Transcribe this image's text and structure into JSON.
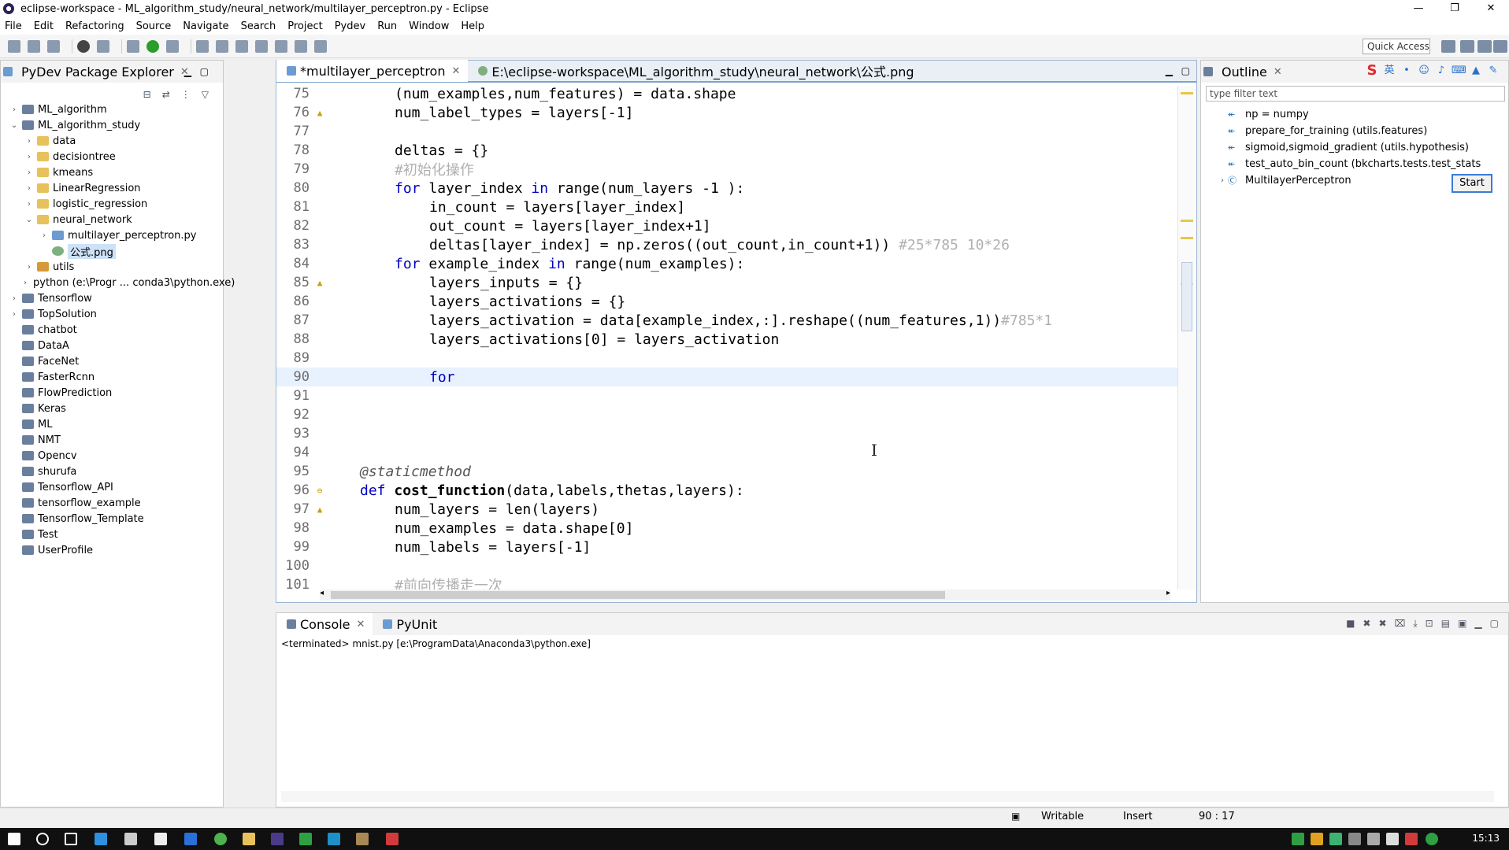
{
  "window": {
    "title": "eclipse-workspace - ML_algorithm_study/neural_network/multilayer_perceptron.py - Eclipse",
    "controls": [
      "—",
      "❐",
      "✕"
    ]
  },
  "menu": [
    "File",
    "Edit",
    "Refactoring",
    "Source",
    "Navigate",
    "Search",
    "Project",
    "Pydev",
    "Run",
    "Window",
    "Help"
  ],
  "toolbar": {
    "quick_access": "Quick Access"
  },
  "explorer": {
    "title": "PyDev Package Explorer",
    "tree": [
      {
        "indent": 0,
        "twisty": "›",
        "icon": "proj",
        "label": "ML_algorithm"
      },
      {
        "indent": 0,
        "twisty": "⌄",
        "icon": "proj",
        "label": "ML_algorithm_study"
      },
      {
        "indent": 1,
        "twisty": "›",
        "icon": "folder",
        "label": "data"
      },
      {
        "indent": 1,
        "twisty": "›",
        "icon": "folder",
        "label": "decisiontree"
      },
      {
        "indent": 1,
        "twisty": "›",
        "icon": "folder",
        "label": "kmeans"
      },
      {
        "indent": 1,
        "twisty": "›",
        "icon": "folder",
        "label": "LinearRegression"
      },
      {
        "indent": 1,
        "twisty": "›",
        "icon": "folder",
        "label": "logistic_regression"
      },
      {
        "indent": 1,
        "twisty": "⌄",
        "icon": "folder",
        "label": "neural_network"
      },
      {
        "indent": 2,
        "twisty": "›",
        "icon": "py",
        "label": "multilayer_perceptron.py"
      },
      {
        "indent": 2,
        "twisty": "",
        "icon": "png",
        "label": "公式.png",
        "selected": true
      },
      {
        "indent": 1,
        "twisty": "›",
        "icon": "pkg",
        "label": "utils"
      },
      {
        "indent": 1,
        "twisty": "›",
        "icon": "py",
        "label": "python   (e:\\Progr ... conda3\\python.exe)"
      },
      {
        "indent": 0,
        "twisty": "›",
        "icon": "proj",
        "label": "Tensorflow"
      },
      {
        "indent": 0,
        "twisty": "›",
        "icon": "proj",
        "label": "TopSolution"
      },
      {
        "indent": 0,
        "twisty": "",
        "icon": "proj",
        "label": "chatbot"
      },
      {
        "indent": 0,
        "twisty": "",
        "icon": "proj",
        "label": "DataA"
      },
      {
        "indent": 0,
        "twisty": "",
        "icon": "proj",
        "label": "FaceNet"
      },
      {
        "indent": 0,
        "twisty": "",
        "icon": "proj",
        "label": "FasterRcnn"
      },
      {
        "indent": 0,
        "twisty": "",
        "icon": "proj",
        "label": "FlowPrediction"
      },
      {
        "indent": 0,
        "twisty": "",
        "icon": "proj",
        "label": "Keras"
      },
      {
        "indent": 0,
        "twisty": "",
        "icon": "proj",
        "label": "ML"
      },
      {
        "indent": 0,
        "twisty": "",
        "icon": "proj",
        "label": "NMT"
      },
      {
        "indent": 0,
        "twisty": "",
        "icon": "proj",
        "label": "Opencv"
      },
      {
        "indent": 0,
        "twisty": "",
        "icon": "proj",
        "label": "shurufa"
      },
      {
        "indent": 0,
        "twisty": "",
        "icon": "proj",
        "label": "Tensorflow_API"
      },
      {
        "indent": 0,
        "twisty": "",
        "icon": "proj",
        "label": "tensorflow_example"
      },
      {
        "indent": 0,
        "twisty": "",
        "icon": "proj",
        "label": "Tensorflow_Template"
      },
      {
        "indent": 0,
        "twisty": "",
        "icon": "proj",
        "label": "Test"
      },
      {
        "indent": 0,
        "twisty": "",
        "icon": "proj",
        "label": "UserProfile"
      }
    ]
  },
  "editor": {
    "tabs": [
      {
        "label": "*multilayer_perceptron",
        "active": true,
        "closable": true
      },
      {
        "label": "E:\\eclipse-workspace\\ML_algorithm_study\\neural_network\\公式.png",
        "active": false,
        "closable": false
      }
    ],
    "current_line": 90,
    "lines": [
      {
        "n": "75",
        "mark": "",
        "indent": 2,
        "parts": [
          [
            "",
            "(num_examples,num_features) = data.shape"
          ]
        ]
      },
      {
        "n": "76",
        "mark": "warn",
        "indent": 2,
        "parts": [
          [
            "",
            "num_label_types = layers[-1]"
          ]
        ]
      },
      {
        "n": "77",
        "mark": "",
        "indent": 0,
        "parts": []
      },
      {
        "n": "78",
        "mark": "",
        "indent": 2,
        "parts": [
          [
            "",
            "deltas = {}"
          ]
        ]
      },
      {
        "n": "79",
        "mark": "",
        "indent": 2,
        "parts": [
          [
            "cm",
            "#初始化操作"
          ]
        ]
      },
      {
        "n": "80",
        "mark": "",
        "indent": 2,
        "parts": [
          [
            "kw",
            "for"
          ],
          [
            "",
            " layer_index "
          ],
          [
            "kw",
            "in"
          ],
          [
            "",
            " range(num_layers -1 ):"
          ]
        ]
      },
      {
        "n": "81",
        "mark": "",
        "indent": 3,
        "parts": [
          [
            "",
            "in_count = layers[layer_index]"
          ]
        ]
      },
      {
        "n": "82",
        "mark": "",
        "indent": 3,
        "parts": [
          [
            "",
            "out_count = layers[layer_index+1]"
          ]
        ]
      },
      {
        "n": "83",
        "mark": "",
        "indent": 3,
        "parts": [
          [
            "",
            "deltas[layer_index] = np.zeros((out_count,in_count+1)) "
          ],
          [
            "cm",
            "#25*785 10*26"
          ]
        ]
      },
      {
        "n": "84",
        "mark": "",
        "indent": 2,
        "parts": [
          [
            "kw",
            "for"
          ],
          [
            "",
            " example_index "
          ],
          [
            "kw",
            "in"
          ],
          [
            "",
            " range(num_examples):"
          ]
        ]
      },
      {
        "n": "85",
        "mark": "warn",
        "indent": 3,
        "parts": [
          [
            "",
            "layers_inputs = {}"
          ]
        ]
      },
      {
        "n": "86",
        "mark": "",
        "indent": 3,
        "parts": [
          [
            "",
            "layers_activations = {}"
          ]
        ]
      },
      {
        "n": "87",
        "mark": "",
        "indent": 3,
        "parts": [
          [
            "",
            "layers_activation = data[example_index,:].reshape((num_features,1))"
          ],
          [
            "cm",
            "#785*1"
          ]
        ]
      },
      {
        "n": "88",
        "mark": "",
        "indent": 3,
        "parts": [
          [
            "",
            "layers_activations[0] = layers_activation"
          ]
        ]
      },
      {
        "n": "89",
        "mark": "",
        "indent": 0,
        "parts": []
      },
      {
        "n": "90",
        "mark": "",
        "indent": 3,
        "parts": [
          [
            "kw",
            "for"
          ]
        ]
      },
      {
        "n": "91",
        "mark": "",
        "indent": 0,
        "parts": []
      },
      {
        "n": "92",
        "mark": "",
        "indent": 0,
        "parts": []
      },
      {
        "n": "93",
        "mark": "",
        "indent": 0,
        "parts": []
      },
      {
        "n": "94",
        "mark": "",
        "indent": 0,
        "parts": []
      },
      {
        "n": "95",
        "mark": "",
        "indent": 1,
        "parts": [
          [
            "dec",
            "@staticmethod"
          ]
        ]
      },
      {
        "n": "96",
        "mark": "fold",
        "indent": 1,
        "parts": [
          [
            "kw",
            "def"
          ],
          [
            "",
            " "
          ],
          [
            "fn",
            "cost_function"
          ],
          [
            "",
            "(data,labels,thetas,layers):"
          ]
        ]
      },
      {
        "n": "97",
        "mark": "warn",
        "indent": 2,
        "parts": [
          [
            "",
            "num_layers = len(layers)"
          ]
        ]
      },
      {
        "n": "98",
        "mark": "",
        "indent": 2,
        "parts": [
          [
            "",
            "num_examples = data.shape[0]"
          ]
        ]
      },
      {
        "n": "99",
        "mark": "",
        "indent": 2,
        "parts": [
          [
            "",
            "num_labels = layers[-1]"
          ]
        ]
      },
      {
        "n": "100",
        "mark": "",
        "indent": 0,
        "parts": []
      },
      {
        "n": "101",
        "mark": "",
        "indent": 2,
        "parts": [
          [
            "cm",
            "#前向传播走一次"
          ]
        ]
      }
    ]
  },
  "outline": {
    "title": "Outline",
    "filter_placeholder": "type filter text",
    "items": [
      {
        "icon": "import",
        "label": "np = numpy"
      },
      {
        "icon": "import",
        "label": "prepare_for_training (utils.features)"
      },
      {
        "icon": "import",
        "label": "sigmoid,sigmoid_gradient (utils.hypothesis)"
      },
      {
        "icon": "import",
        "label": "test_auto_bin_count (bkcharts.tests.test_stats"
      },
      {
        "icon": "class",
        "label": "MultilayerPerceptron"
      }
    ],
    "start_button": "Start",
    "ime_lang": "英"
  },
  "console": {
    "tabs": [
      {
        "label": "Console",
        "active": true
      },
      {
        "label": "PyUnit",
        "active": false
      }
    ],
    "status": "<terminated> mnist.py [e:\\ProgramData\\Anaconda3\\python.exe]"
  },
  "statusbar": {
    "writable": "Writable",
    "insert_mode": "Insert",
    "position": "90 : 17"
  },
  "taskbar": {
    "time": "15:13"
  }
}
